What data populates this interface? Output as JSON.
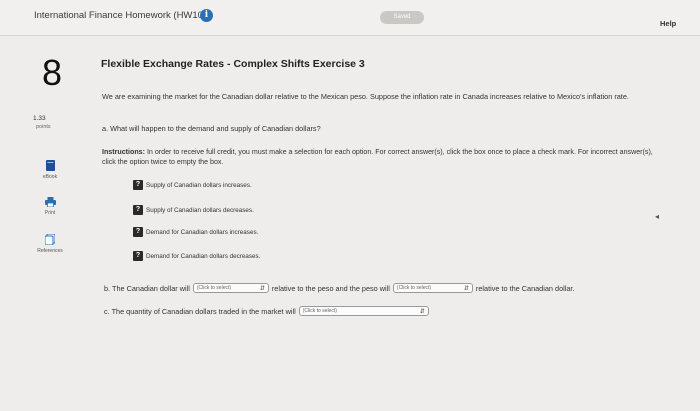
{
  "header": {
    "assignment_title": "International Finance Homework (HW10)",
    "info_icon": "i",
    "saved_label": "Saved",
    "help_label": "Help"
  },
  "sidebar": {
    "question_number": "8",
    "points_value": "1.33",
    "points_label": "points",
    "tools": [
      {
        "label": "eBook",
        "icon": "ebook-icon"
      },
      {
        "label": "Print",
        "icon": "print-icon"
      },
      {
        "label": "References",
        "icon": "references-icon"
      }
    ]
  },
  "question": {
    "title": "Flexible Exchange Rates - Complex Shifts Exercise 3",
    "intro": "We are examining the market for the Canadian dollar relative to the Mexican peso. Suppose the inflation rate in Canada increases relative to Mexico's inflation rate.",
    "part_a": "a. What will happen to the demand and supply of Canadian dollars?",
    "instructions_label": "Instructions:",
    "instructions_text": "In order to receive full credit, you must make a selection for each option. For correct answer(s), click the box once to place a check mark. For incorrect answer(s), click the option twice to empty the box.",
    "options": [
      {
        "mark": "?",
        "text": "Supply of Canadian dollars increases."
      },
      {
        "mark": "?",
        "text": "Supply of Canadian dollars decreases."
      },
      {
        "mark": "?",
        "text": "Demand for Canadian dollars increases."
      },
      {
        "mark": "?",
        "text": "Demand for Canadian dollars decreases."
      }
    ],
    "part_b_start": "b. The Canadian dollar will",
    "part_b_mid": "relative to the peso and the peso will",
    "part_b_end": "relative to the Canadian dollar.",
    "part_c_start": "c. The quantity of Canadian dollars traded in the market will",
    "select_placeholder": "(Click to select)"
  }
}
